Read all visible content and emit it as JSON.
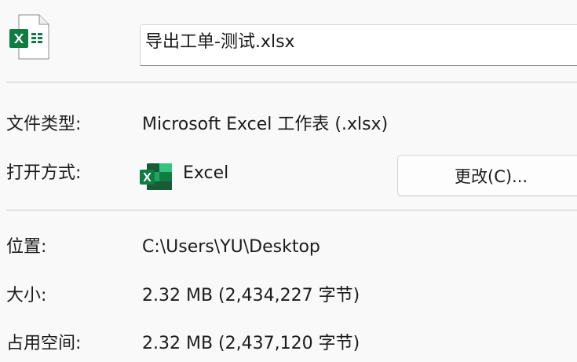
{
  "file": {
    "name": "导出工单-测试.xlsx",
    "icon": "excel-file-icon"
  },
  "type": {
    "label": "文件类型:",
    "value": "Microsoft Excel 工作表 (.xlsx)"
  },
  "opens_with": {
    "label": "打开方式:",
    "app_name": "Excel",
    "app_icon": "excel-app-icon",
    "change_button": "更改(C)..."
  },
  "location": {
    "label": "位置:",
    "value": "C:\\Users\\YU\\Desktop"
  },
  "size": {
    "label": "大小:",
    "value": "2.32 MB (2,434,227 字节)"
  },
  "size_on_disk": {
    "label": "占用空间:",
    "value": "2.32 MB (2,437,120 字节)"
  },
  "colors": {
    "excel_green": "#107c41",
    "excel_dark_green": "#185c37",
    "excel_light_green": "#33c481"
  }
}
